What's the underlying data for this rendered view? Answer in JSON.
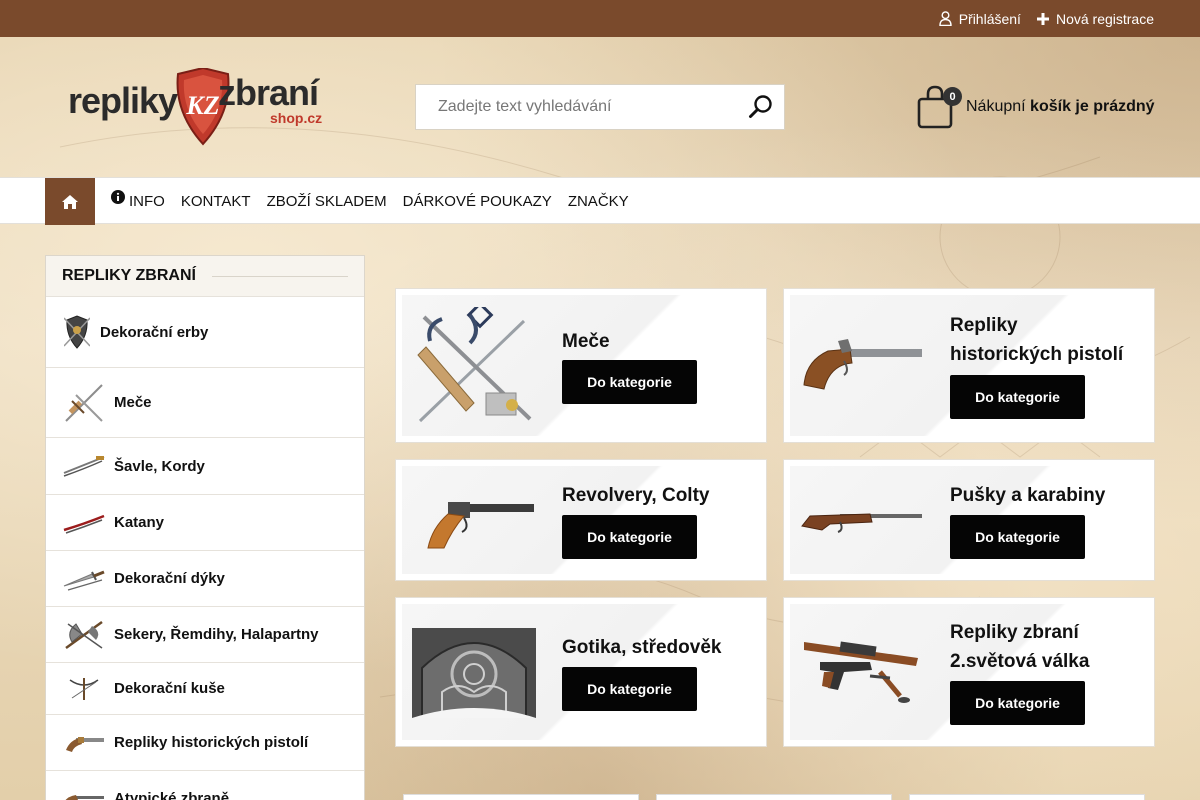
{
  "topbar": {
    "login_label": "Přihlášení",
    "register_label": "Nová registrace"
  },
  "header": {
    "logo": {
      "word1": "repliky",
      "word2": "zbraní",
      "word3": "shop.cz",
      "shield_text": "KZ"
    },
    "search": {
      "placeholder": "Zadejte text vyhledávání",
      "value": ""
    },
    "cart": {
      "count": "0",
      "label_prefix": "Nákupní",
      "label_status": "košík je prázdný"
    }
  },
  "nav": {
    "items": [
      {
        "label": "INFO",
        "icon": "info-icon"
      },
      {
        "label": "KONTAKT"
      },
      {
        "label": "ZBOŽÍ SKLADEM"
      },
      {
        "label": "DÁRKOVÉ POUKAZY"
      },
      {
        "label": "ZNAČKY"
      }
    ]
  },
  "sidebar": {
    "title": "REPLIKY ZBRANÍ",
    "categories": [
      {
        "label": "Dekorační erby",
        "icon": "coat-of-arms-icon"
      },
      {
        "label": "Meče",
        "icon": "swords-icon"
      },
      {
        "label": "Šavle, Kordy",
        "icon": "sabre-icon"
      },
      {
        "label": "Katany",
        "icon": "katana-icon"
      },
      {
        "label": "Dekorační dýky",
        "icon": "dagger-icon"
      },
      {
        "label": "Sekery, Řemdihy, Halapartny",
        "icon": "axe-icon"
      },
      {
        "label": "Dekorační kuše",
        "icon": "crossbow-icon"
      },
      {
        "label": "Repliky historických pistolí",
        "icon": "pistol-icon"
      },
      {
        "label": "Atypické zbraně",
        "icon": "atypical-weapon-icon"
      }
    ]
  },
  "cards": [
    {
      "title_lines": [
        "Meče"
      ],
      "button": "Do kategorie",
      "image": "crossed-swords-image"
    },
    {
      "title_lines": [
        "Repliky",
        "historických pistolí"
      ],
      "button": "Do kategorie",
      "image": "flintlock-pistol-image"
    },
    {
      "title_lines": [
        "Revolvery, Colty"
      ],
      "button": "Do kategorie",
      "image": "revolver-image"
    },
    {
      "title_lines": [
        "Pušky a karabiny"
      ],
      "button": "Do kategorie",
      "image": "rifle-image"
    },
    {
      "title_lines": [
        "Gotika, středověk"
      ],
      "button": "Do kategorie",
      "image": "gothic-window-image"
    },
    {
      "title_lines": [
        "Repliky zbraní",
        "2.světová válka"
      ],
      "button": "Do kategorie",
      "image": "ww2-weapons-image"
    }
  ],
  "colors": {
    "brand_brown": "#7a4a2c",
    "button_black": "#050505",
    "logo_red": "#c0392b"
  }
}
